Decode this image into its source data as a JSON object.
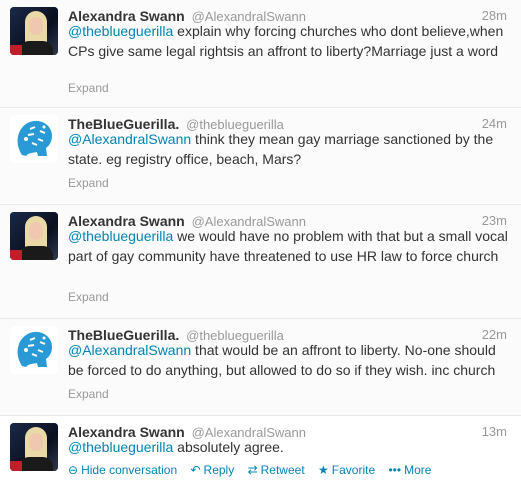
{
  "tweets": [
    {
      "name": "Alexandra Swann",
      "handle": "@AlexandralSwann",
      "time": "28m",
      "mention": "@theblueguerilla",
      "text": " explain why forcing churches who dont believe,when CPs give same legal rightsis an affront to liberty?Marriage just a word",
      "expand": "Expand",
      "avatar_icon": "profile-photo-woman-blonde"
    },
    {
      "name": "TheBlueGuerilla.",
      "handle": "@theblueguerilla",
      "time": "24m",
      "mention": "@AlexandralSwann",
      "text": " think they mean gay marriage sanctioned by the state. eg registry office, beach, Mars?",
      "expand": "Expand",
      "avatar_icon": "blue-guerilla-head-logo"
    },
    {
      "name": "Alexandra Swann",
      "handle": "@AlexandralSwann",
      "time": "23m",
      "mention": "@theblueguerilla",
      "text": " we would have no problem with that but a small vocal part of gay community have threatened to use HR law to force church",
      "expand": "Expand",
      "avatar_icon": "profile-photo-woman-blonde"
    },
    {
      "name": "TheBlueGuerilla.",
      "handle": "@theblueguerilla",
      "time": "22m",
      "mention": "@AlexandralSwann",
      "text": " that would be an affront to liberty. No-one should be forced to do anything, but allowed to do so if they wish. inc church",
      "expand": "Expand",
      "avatar_icon": "blue-guerilla-head-logo"
    },
    {
      "name": "Alexandra Swann",
      "handle": "@AlexandralSwann",
      "time": "13m",
      "mention": "@theblueguerilla",
      "text": " absolutely agree.",
      "avatar_icon": "profile-photo-woman-blonde",
      "actions": {
        "hide": "Hide conversation",
        "reply": "Reply",
        "retweet": "Retweet",
        "favorite": "Favorite",
        "more": "More"
      }
    }
  ],
  "colors": {
    "link": "#0084b4",
    "muted": "#999999",
    "text": "#333333",
    "logo_blue": "#2a9ad6"
  }
}
